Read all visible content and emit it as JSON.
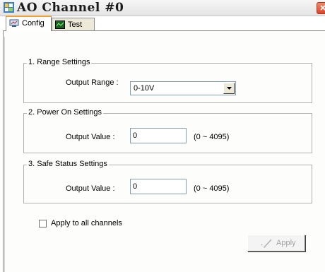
{
  "window": {
    "title": "AO Channel #0",
    "icon": "app-icon",
    "close_icon": "close-icon"
  },
  "tabs": [
    {
      "label": "Config",
      "icon": "config-icon",
      "active": true
    },
    {
      "label": "Test",
      "icon": "test-icon",
      "active": false
    }
  ],
  "range_settings": {
    "title": "1. Range Settings",
    "output_range_label": "Output Range :",
    "output_range_value": "0-10V",
    "dropdown_icon": "chevron-down-icon"
  },
  "power_on_settings": {
    "title": "2. Power On Settings",
    "output_value_label": "Output Value :",
    "output_value": "0",
    "range_hint": "(0 ~ 4095)"
  },
  "safe_status_settings": {
    "title": "3. Safe Status Settings",
    "output_value_label": "Output Value :",
    "output_value": "0",
    "range_hint": "(0 ~ 4095)"
  },
  "apply_all": {
    "label": "Apply to all channels",
    "checked": false
  },
  "apply_button": {
    "label": "Apply",
    "enabled": false,
    "icon": "checkmark-icon"
  },
  "colors": {
    "tab_active_accent": "#f0a030",
    "disabled_text": "#a0a0a0",
    "input_border": "#7f9db9"
  }
}
